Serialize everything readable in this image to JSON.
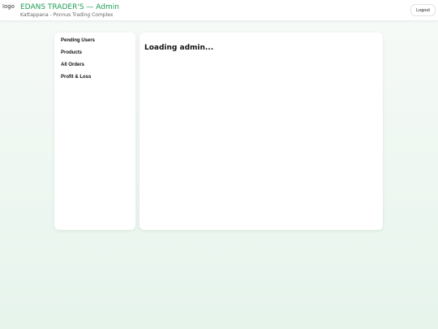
{
  "header": {
    "logo_alt": "logo",
    "title": "EDANS TRADER'S — Admin",
    "subtitle": "Kattappana - Ponnus Trading Complex",
    "logout_label": "Logout"
  },
  "sidebar": {
    "items": [
      {
        "label": "Pending Users"
      },
      {
        "label": "Products"
      },
      {
        "label": "All Orders"
      },
      {
        "label": "Profit & Loss"
      }
    ]
  },
  "main": {
    "status": "Loading admin..."
  },
  "colors": {
    "brand": "#1f9d55",
    "background": "#eef7f1"
  }
}
